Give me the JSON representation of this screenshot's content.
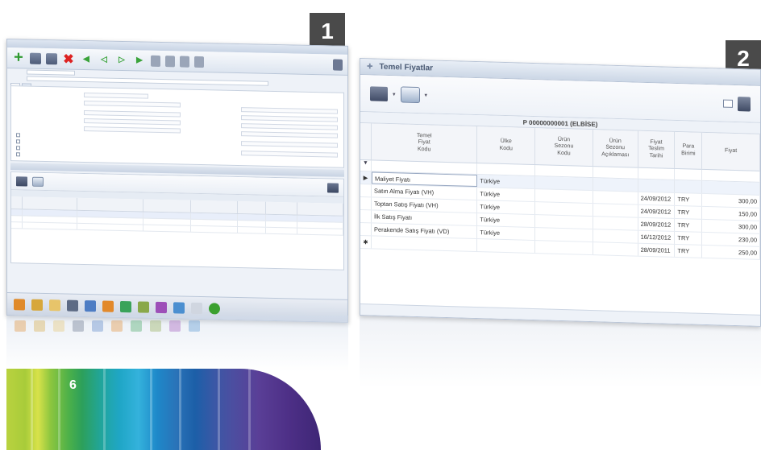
{
  "badges": {
    "screen1": "1",
    "screen2": "2"
  },
  "page_number": "6",
  "screen2": {
    "window_title": "Temel Fiyatlar",
    "grid_title": "P 00000000001 (ELBİSE)",
    "columns": [
      "Temel\nFiyat\nKodu",
      "Ülke\nKodu",
      "Ürün\nSezonu\nKodu",
      "Ürün\nSezonu\nAçıklaması",
      "Fiyat\nTeslim\nTarihi",
      "Para\nBirimi",
      "Fiyat"
    ],
    "rows": [
      {
        "name": "Maliyet Fiyatı",
        "country": "Türkiye",
        "date": "",
        "currency": "",
        "price": ""
      },
      {
        "name": "Satın Alma Fiyatı (VH)",
        "country": "Türkiye",
        "date": "24/09/2012",
        "currency": "TRY",
        "price": "300,00"
      },
      {
        "name": "Toptan Satış Fiyatı (VH)",
        "country": "Türkiye",
        "date": "24/09/2012",
        "currency": "TRY",
        "price": "150,00"
      },
      {
        "name": "İlk Satış Fiyatı",
        "country": "Türkiye",
        "date": "28/09/2012",
        "currency": "TRY",
        "price": "300,00"
      },
      {
        "name": "Perakende Satış Fiyatı (VD)",
        "country": "Türkiye",
        "date": "16/12/2012",
        "currency": "TRY",
        "price": "230,00"
      },
      {
        "name": "",
        "country": "",
        "date": "28/09/2011",
        "currency": "TRY",
        "price": "250,00"
      }
    ]
  },
  "colors": {
    "badge": "#4a4a4a",
    "window_border": "#b8c4d6",
    "toolbar_green": "#2f9a2f",
    "toolbar_red": "#dd2222"
  },
  "icons": [
    "add-icon",
    "save-icon",
    "save-as-icon",
    "delete-icon",
    "first-icon",
    "previous-icon",
    "next-icon",
    "last-icon",
    "folder-icon",
    "print-icon",
    "export-icon",
    "exit-icon"
  ]
}
